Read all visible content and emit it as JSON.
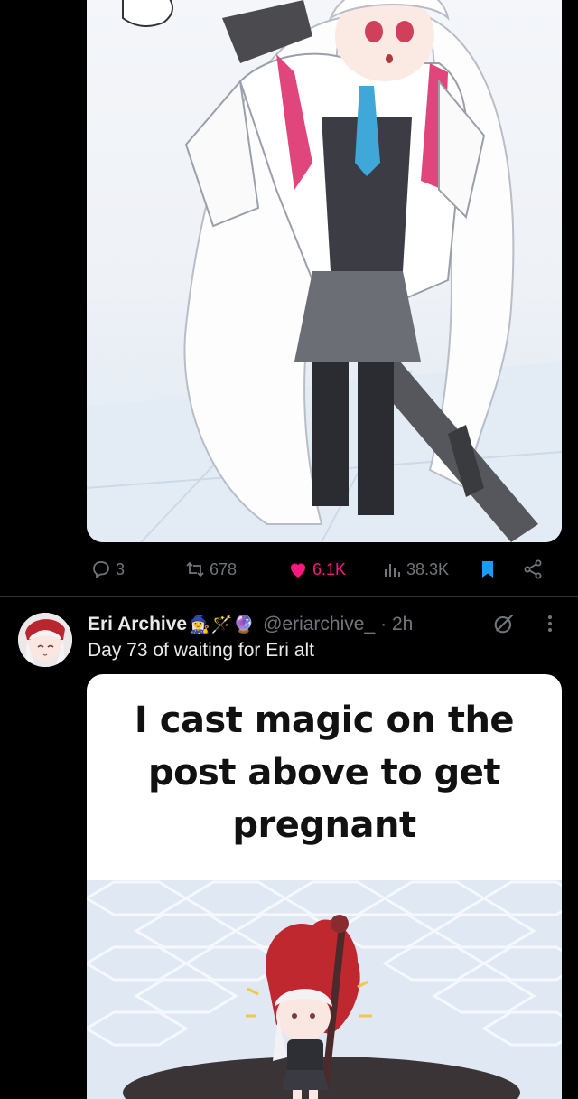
{
  "first_tweet": {
    "actions": {
      "replies": "3",
      "reposts": "678",
      "likes": "6.1K",
      "views": "38.3K"
    }
  },
  "second_tweet": {
    "display_name": "Eri Archive",
    "name_emojis": "🧙‍♀️🪄🔮",
    "handle": "@eriarchive_",
    "time": "· 2h",
    "text": "Day 73 of waiting for Eri alt",
    "meme": {
      "line1": "I cast magic on the",
      "line2": "post above to get",
      "line3": "pregnant"
    }
  },
  "colors": {
    "background": "#000000",
    "text": "#e7e9ea",
    "muted": "#71767b",
    "like": "#f91880",
    "bookmark": "#1d9bf0",
    "divider": "#2f3336"
  },
  "icons": [
    "reply-icon",
    "repost-icon",
    "like-icon",
    "views-icon",
    "bookmark-icon",
    "share-icon",
    "grok-icon",
    "more-icon"
  ]
}
